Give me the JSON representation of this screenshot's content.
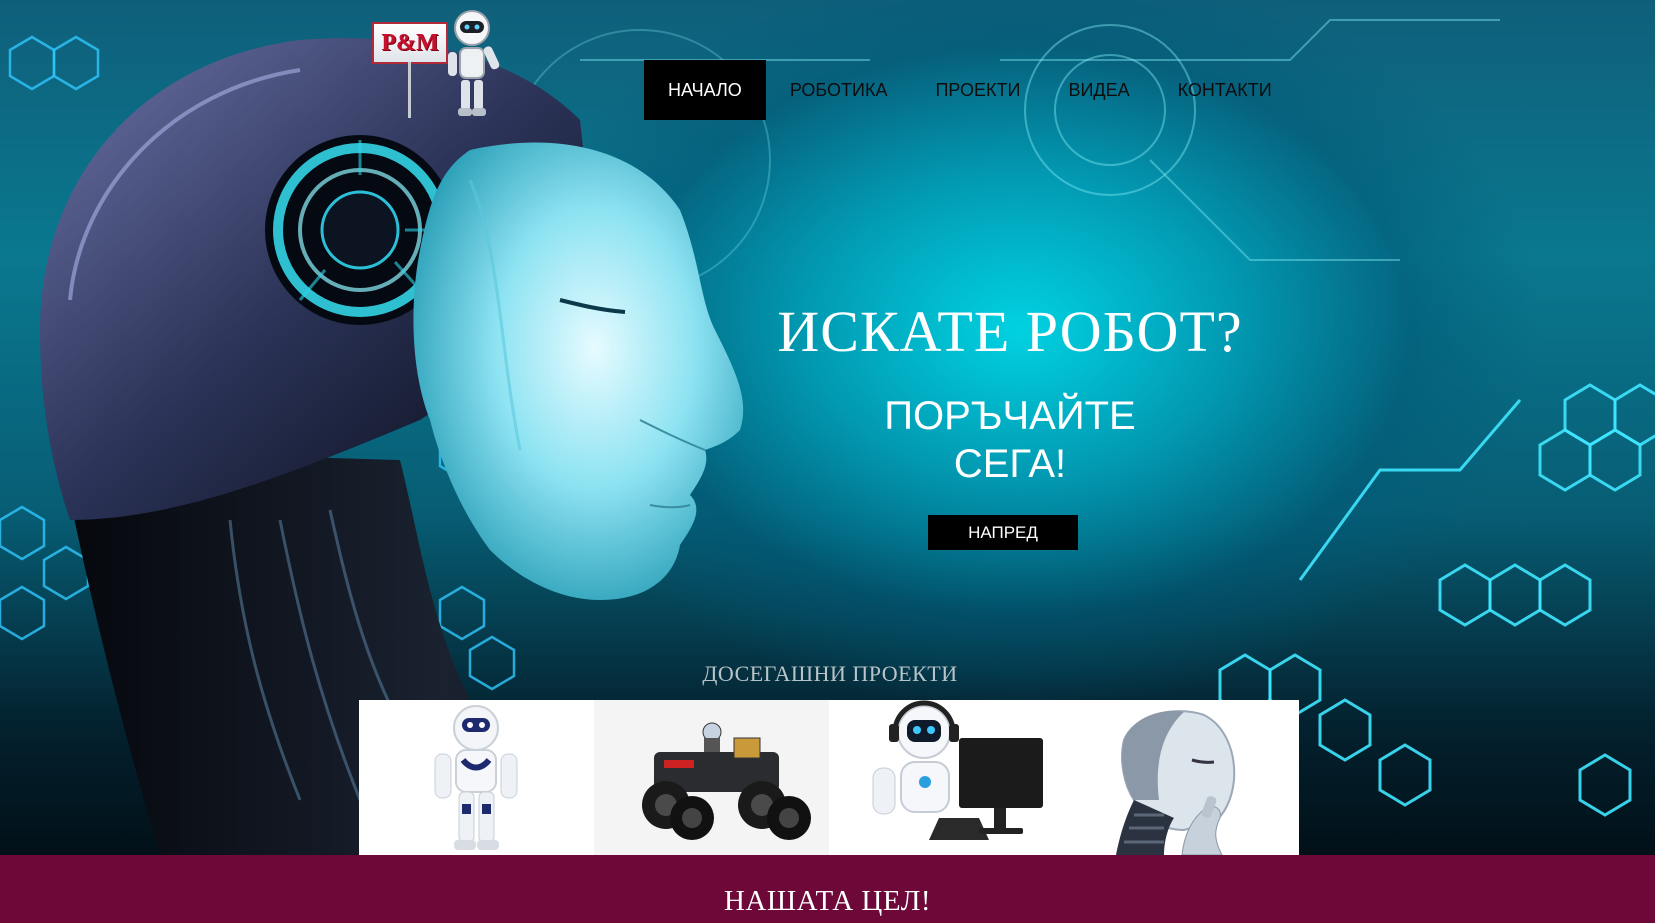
{
  "logo": {
    "text": "P&M",
    "icon": "robot-mascot-icon"
  },
  "nav": {
    "items": [
      {
        "label": "НАЧАЛО",
        "active": true
      },
      {
        "label": "РОБОТИКА",
        "active": false
      },
      {
        "label": "ПРОЕКТИ",
        "active": false
      },
      {
        "label": "ВИДЕА",
        "active": false
      },
      {
        "label": "КОНТАКТИ",
        "active": false
      }
    ]
  },
  "hero": {
    "title": "ИСКАТЕ РОБОТ?",
    "subtitle_line1": "ПОРЪЧАЙТЕ",
    "subtitle_line2": "СЕГА!",
    "button_label": "НАПРЕД",
    "background_icon": "android-head-icon"
  },
  "projects": {
    "title": "ДОСЕГАШНИ ПРОЕКТИ",
    "items": [
      {
        "icon": "humanoid-robot-icon"
      },
      {
        "icon": "rover-robot-icon"
      },
      {
        "icon": "support-robot-computer-icon"
      },
      {
        "icon": "thinking-android-icon"
      }
    ]
  },
  "goal": {
    "title": "НАШАТА ЦЕЛ!"
  },
  "colors": {
    "hero_cyan": "#00d7e6",
    "nav_active_bg": "#000000",
    "band": "#6d0838"
  }
}
